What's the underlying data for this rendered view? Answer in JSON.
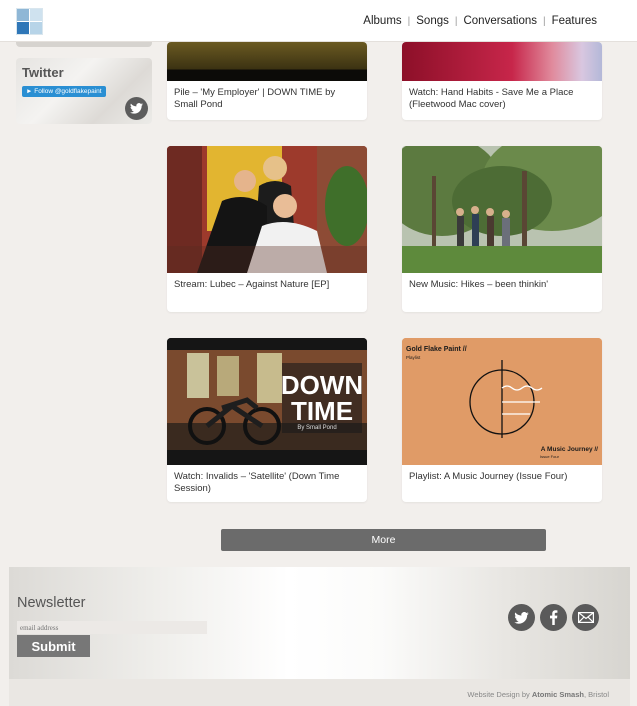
{
  "header": {
    "nav": [
      "Albums",
      "Songs",
      "Conversations",
      "Features"
    ]
  },
  "sidebar": {
    "twitter": {
      "title": "Twitter",
      "follow_label": "Follow @goldflakepaint",
      "icon": "twitter-icon"
    }
  },
  "posts": [
    {
      "caption": "Pile – 'My Employer' | DOWN TIME by Small Pond"
    },
    {
      "caption": "Watch: Hand Habits - Save Me a Place (Fleetwood Mac cover)"
    },
    {
      "caption": "Stream: Lubec – Against Nature [EP]"
    },
    {
      "caption": "New Music: Hikes – been thinkin'"
    },
    {
      "caption": "Watch: Invalids – 'Satellite' (Down Time Session)",
      "image_text": {
        "big": "DOWN TIME",
        "small": "By Small Pond"
      }
    },
    {
      "caption": "Playlist: A Music Journey (Issue Four)",
      "image_text": {
        "brand": "Gold Flake Paint //",
        "sub": "Playlist",
        "title": "A Music Journey //",
        "issue": "Issue Four"
      }
    }
  ],
  "more_label": "More",
  "footer": {
    "newsletter_title": "Newsletter",
    "email_placeholder": "email address",
    "submit_label": "Submit",
    "social_icons": [
      "twitter-icon",
      "facebook-icon",
      "mail-icon"
    ],
    "credit_prefix": "Website Design by ",
    "credit_company": "Atomic Smash",
    "credit_suffix": ", Bristol"
  },
  "colors": {
    "page_bg": "#f2efec",
    "button_bg": "#6b6b6b",
    "twitter_blue": "#2a8fd3",
    "playlist_bg": "#e09b67"
  }
}
